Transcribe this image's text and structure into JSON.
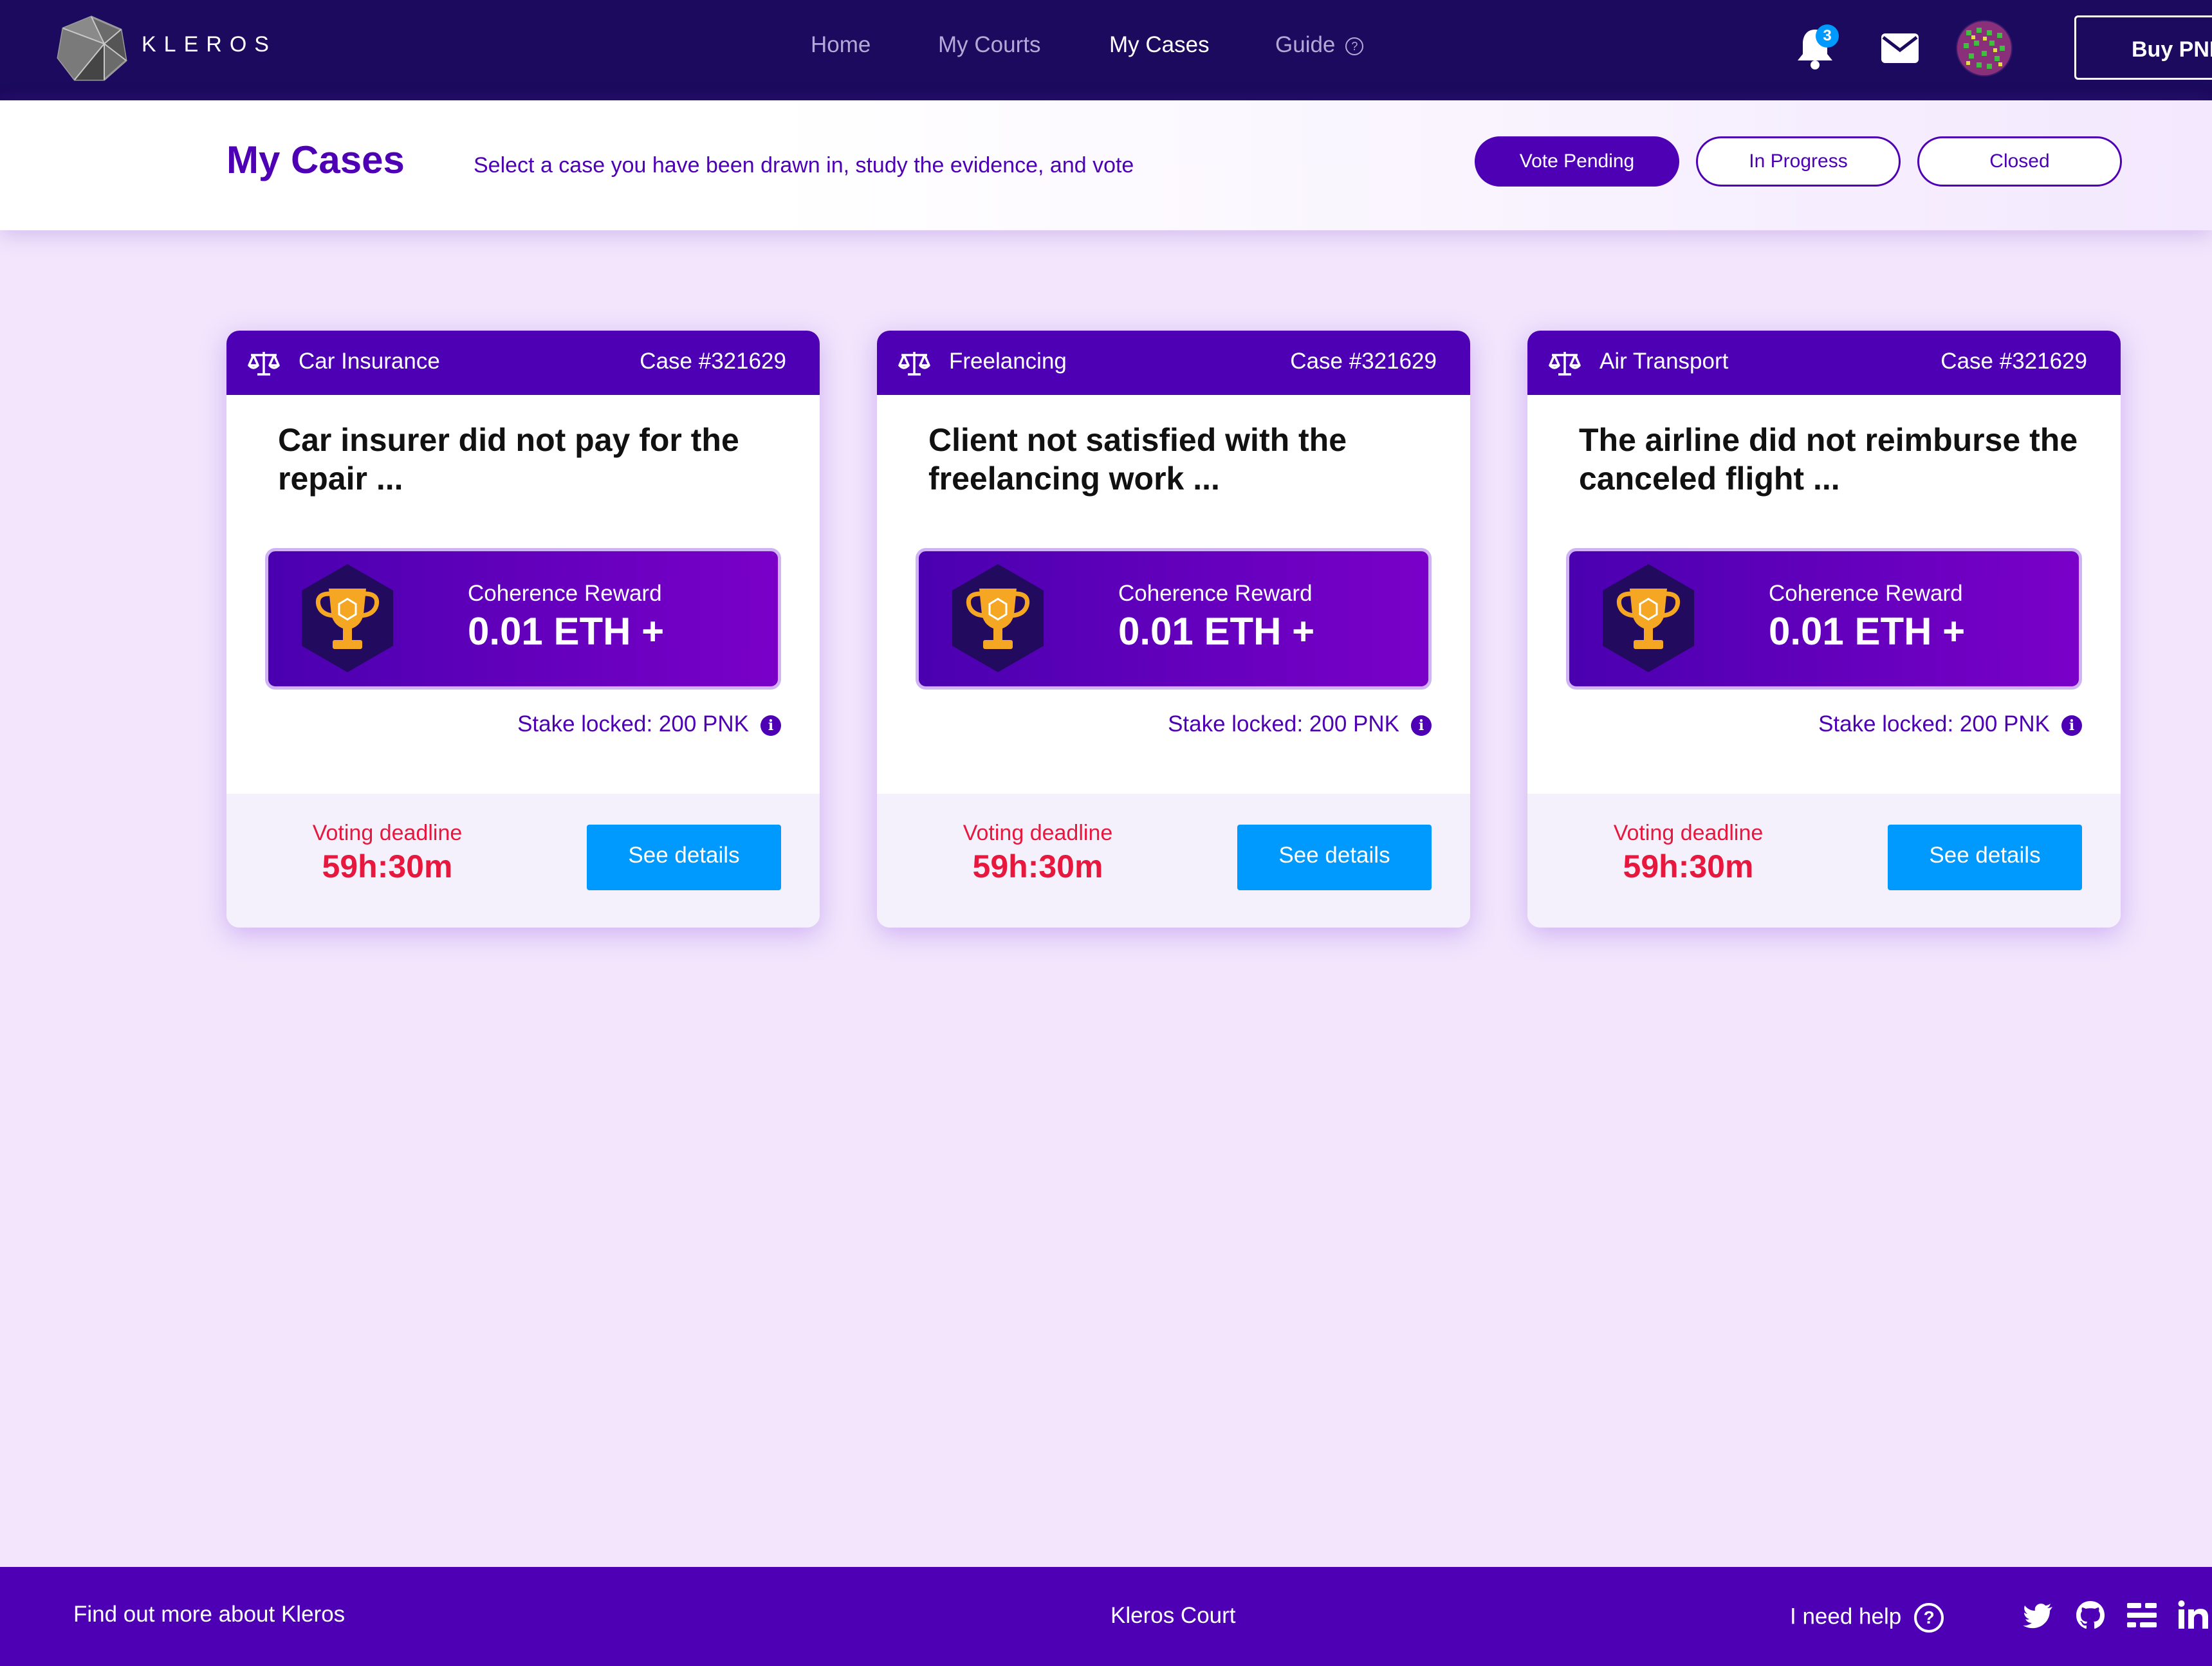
{
  "brand": {
    "name": "KLEROS"
  },
  "nav": {
    "links": [
      {
        "label": "Home"
      },
      {
        "label": "My Courts"
      },
      {
        "label": "My Cases"
      },
      {
        "label": "Guide"
      }
    ],
    "notifications_count": "3",
    "buy_label": "Buy PNK"
  },
  "header": {
    "title": "My Cases",
    "subtitle": "Select a case you have been drawn in, study the evidence, and vote",
    "filters": [
      {
        "label": "Vote Pending",
        "active": true
      },
      {
        "label": "In Progress",
        "active": false
      },
      {
        "label": "Closed",
        "active": false
      }
    ]
  },
  "cases": [
    {
      "court": "Car Insurance",
      "case_no": "Case #321629",
      "title": "Car insurer did not pay for the repair ...",
      "reward_label": "Coherence Reward",
      "reward_value": "0.01 ETH +",
      "stake": "Stake locked: 200 PNK",
      "deadline_label": "Voting deadline",
      "deadline_value": "59h:30m",
      "button": "See details"
    },
    {
      "court": "Freelancing",
      "case_no": "Case #321629",
      "title": "Client not satisfied with the freelancing work ...",
      "reward_label": "Coherence Reward",
      "reward_value": "0.01 ETH +",
      "stake": "Stake locked: 200 PNK",
      "deadline_label": "Voting deadline",
      "deadline_value": "59h:30m",
      "button": "See details"
    },
    {
      "court": "Air Transport",
      "case_no": "Case #321629",
      "title": "The airline did not reimburse the canceled flight ...",
      "reward_label": "Coherence Reward",
      "reward_value": "0.01 ETH +",
      "stake": "Stake locked: 200 PNK",
      "deadline_label": "Voting deadline",
      "deadline_value": "59h:30m",
      "button": "See details"
    }
  ],
  "footer": {
    "left": "Find out more about Kleros",
    "center": "Kleros Court",
    "help": "I need help",
    "social": [
      "twitter-icon",
      "github-icon",
      "blog-icon",
      "linkedin-icon"
    ]
  },
  "colors": {
    "nav_bg": "#1c0a5e",
    "primary": "#4d00b4",
    "accent_blue": "#009aff",
    "deadline_red": "#e8173d",
    "page_bg": "#f2e5fc"
  }
}
